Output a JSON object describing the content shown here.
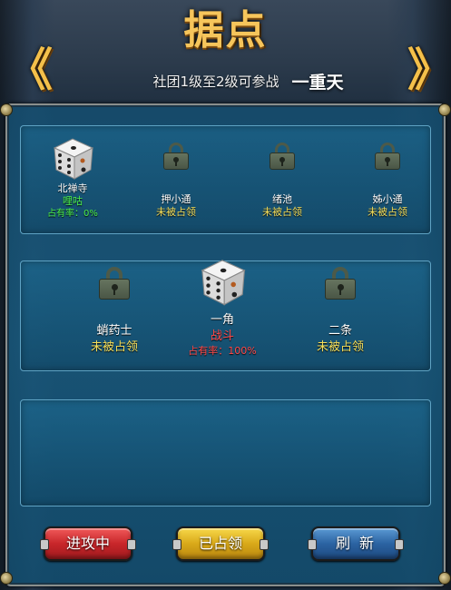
{
  "header": {
    "title": "据点",
    "subtitle": "社团1级至2级可参战",
    "tier": "一重天",
    "nav_prev_glyph": "《",
    "nav_next_glyph": "》"
  },
  "row1": [
    {
      "name": "北禅寺",
      "icon": "dice-icon",
      "status": "哩咕",
      "status_color": "#4cf04c",
      "rate": "占有率：0%"
    },
    {
      "name": "押小通",
      "icon": "lock-icon",
      "status": "未被占领",
      "status_color": "#f6df5a"
    },
    {
      "name": "绪池",
      "icon": "lock-icon",
      "status": "未被占领",
      "status_color": "#f6df5a"
    },
    {
      "name": "姊小通",
      "icon": "lock-icon",
      "status": "未被占领",
      "status_color": "#f6df5a"
    }
  ],
  "row2": [
    {
      "name": "蛸药士",
      "icon": "lock-icon",
      "status": "未被占领",
      "status_color": "#f6df5a"
    },
    {
      "name": "一角",
      "icon": "dice-icon",
      "status": "战斗",
      "status_color": "#ff4a4a",
      "rate": "占有率：100%"
    },
    {
      "name": "二条",
      "icon": "lock-icon",
      "status": "未被占领",
      "status_color": "#f6df5a"
    }
  ],
  "buttons": {
    "attacking": "进攻中",
    "occupied": "已占领",
    "refresh": "刷新"
  },
  "colors": {
    "title_gold": "#f6c55b",
    "panel_blue": "#165c82",
    "btn_red": "#c8262a",
    "btn_yellow": "#d9a919",
    "btn_blue": "#2b63a2"
  }
}
